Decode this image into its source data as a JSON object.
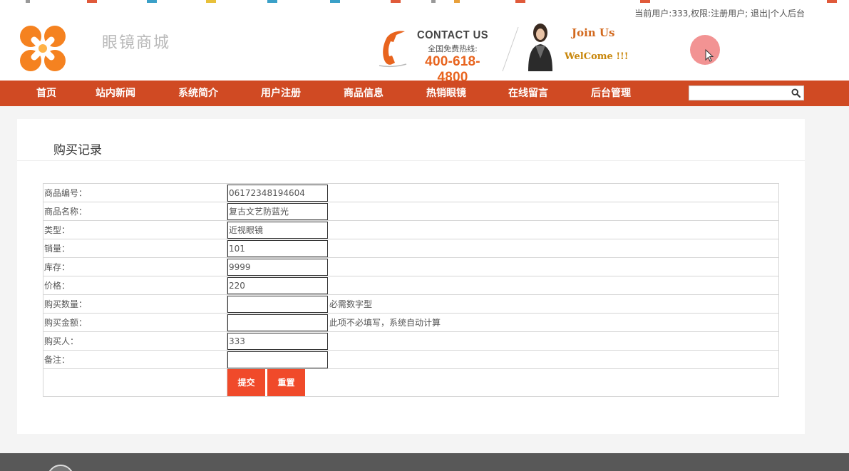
{
  "user_info": {
    "text": "当前用户:333,权限:注册用户; 退出|个人后台"
  },
  "header": {
    "site_name": "眼镜商城",
    "contact_title": "CONTACT US",
    "contact_sub": "全国免费热线:",
    "contact_phone": "400-618-4800",
    "join_title": "Join Us",
    "welcome_text": "WelCome !!!"
  },
  "nav": {
    "items": [
      {
        "label": "首页"
      },
      {
        "label": "站内新闻"
      },
      {
        "label": "系统简介"
      },
      {
        "label": "用户注册"
      },
      {
        "label": "商品信息"
      },
      {
        "label": "热销眼镜"
      },
      {
        "label": "在线留言"
      },
      {
        "label": "后台管理"
      }
    ],
    "search_value": ""
  },
  "panel": {
    "title": "购买记录"
  },
  "form": {
    "rows": [
      {
        "label": "商品编号：",
        "value": "06172348194604",
        "hint": ""
      },
      {
        "label": "商品名称：",
        "value": "复古文艺防蓝光",
        "hint": ""
      },
      {
        "label": "类型：",
        "value": "近视眼镜",
        "hint": ""
      },
      {
        "label": "销量：",
        "value": "101",
        "hint": ""
      },
      {
        "label": "库存：",
        "value": "9999",
        "hint": ""
      },
      {
        "label": "价格：",
        "value": "220",
        "hint": ""
      },
      {
        "label": "购买数量：",
        "value": "",
        "hint": "必需数字型"
      },
      {
        "label": "购买金额：",
        "value": "",
        "hint": "此项不必填写，系统自动计算"
      },
      {
        "label": "购买人：",
        "value": "333",
        "hint": ""
      },
      {
        "label": "备注：",
        "value": "",
        "hint": ""
      }
    ],
    "submit_label": "提交",
    "reset_label": "重置"
  },
  "colors": {
    "nav_bg": "#d04a23",
    "button_bg": "#f04a2a",
    "phone_orange": "#e8641e",
    "footer_bg": "#585858"
  },
  "icons": {
    "logo": "orange-x-logo-icon",
    "phone": "phone-handset-icon",
    "search": "magnifier-icon",
    "cursor": "mouse-cursor-icon"
  }
}
